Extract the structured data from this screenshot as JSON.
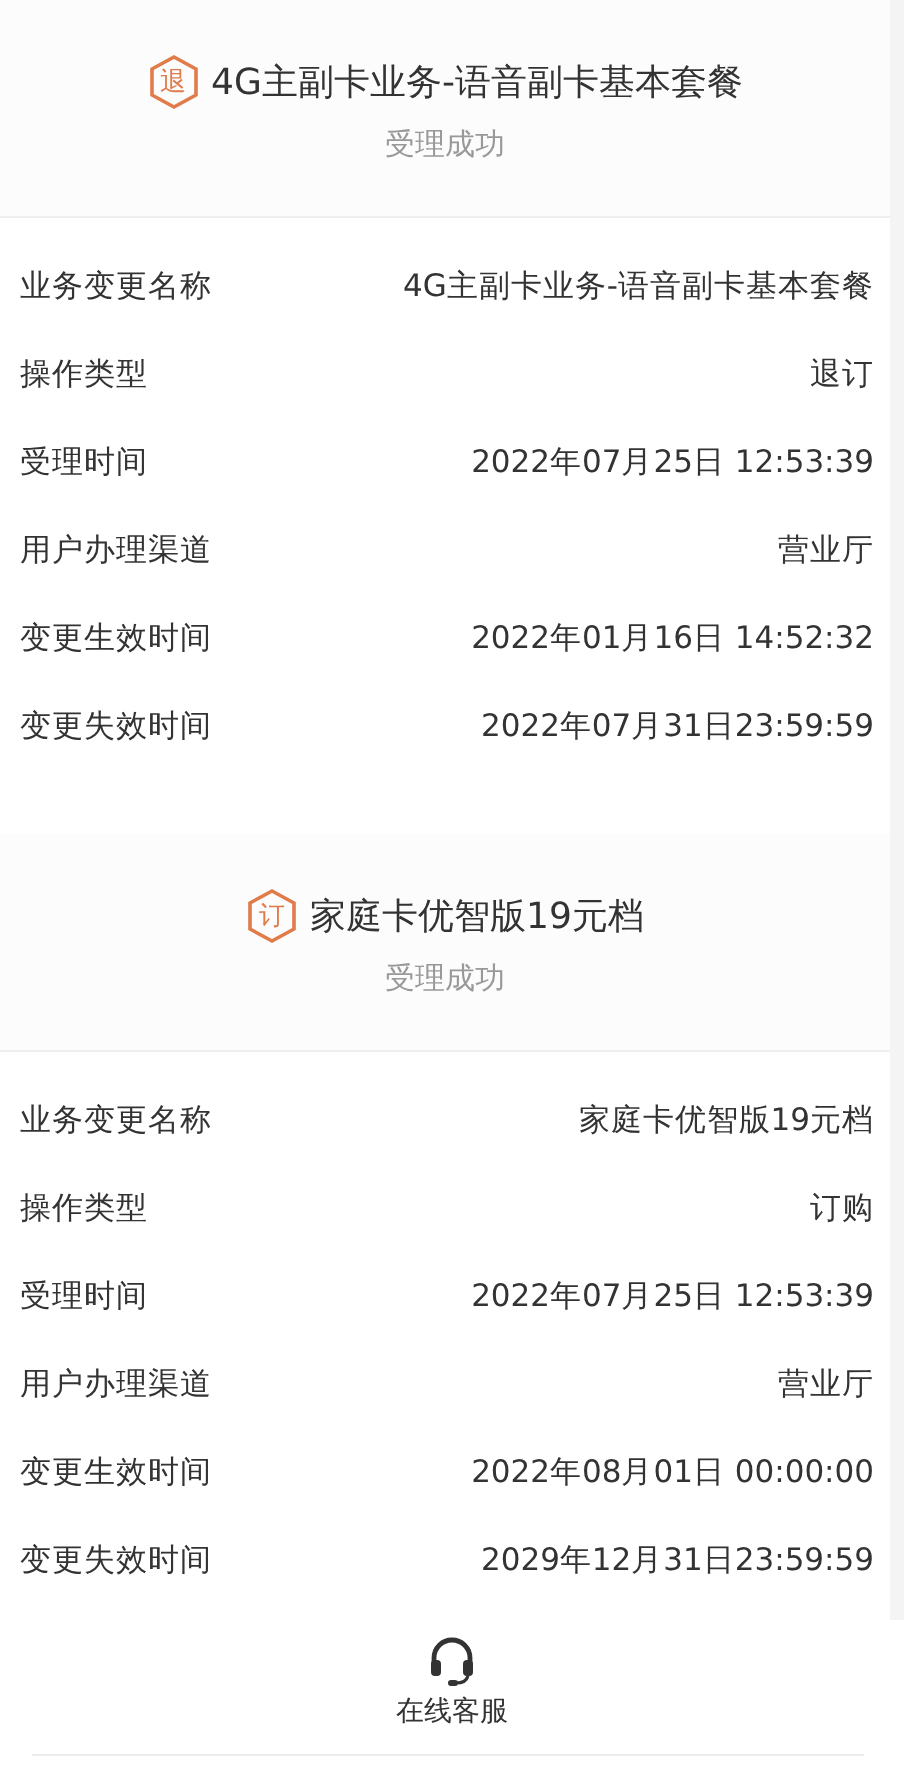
{
  "orders": [
    {
      "badge": "退",
      "title": "4G主副卡业务-语音副卡基本套餐",
      "status": "受理成功",
      "fields": [
        {
          "label": "业务变更名称",
          "value": "4G主副卡业务-语音副卡基本套餐"
        },
        {
          "label": "操作类型",
          "value": "退订"
        },
        {
          "label": "受理时间",
          "value": "2022年07月25日 12:53:39"
        },
        {
          "label": "用户办理渠道",
          "value": "营业厅"
        },
        {
          "label": "变更生效时间",
          "value": "2022年01月16日 14:52:32"
        },
        {
          "label": "变更失效时间",
          "value": "2022年07月31日23:59:59"
        }
      ]
    },
    {
      "badge": "订",
      "title": "家庭卡优智版19元档",
      "status": "受理成功",
      "fields": [
        {
          "label": "业务变更名称",
          "value": "家庭卡优智版19元档"
        },
        {
          "label": "操作类型",
          "value": "订购"
        },
        {
          "label": "受理时间",
          "value": "2022年07月25日 12:53:39"
        },
        {
          "label": "用户办理渠道",
          "value": "营业厅"
        },
        {
          "label": "变更生效时间",
          "value": "2022年08月01日 00:00:00"
        },
        {
          "label": "变更失效时间",
          "value": "2029年12月31日23:59:59"
        }
      ]
    }
  ],
  "footer": {
    "label": "在线客服"
  }
}
